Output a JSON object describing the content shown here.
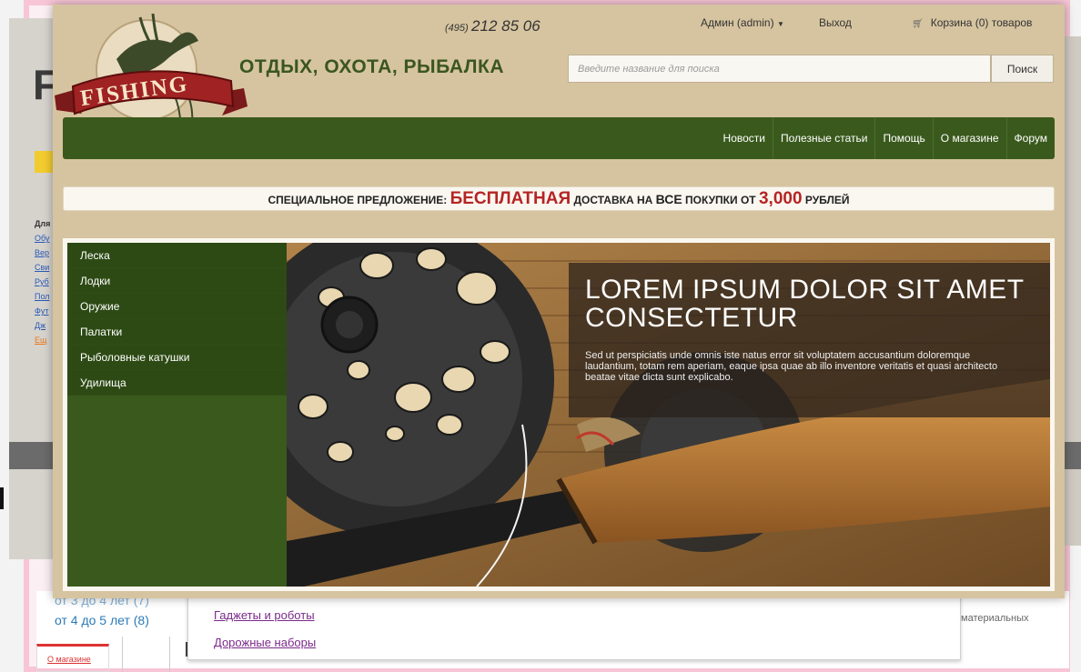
{
  "background": {
    "logo_fragment": "F",
    "side_links": [
      "Для",
      "Обу",
      "Вер",
      "Сви",
      "Руб",
      "Пол",
      "Фут",
      "Дж",
      "Ещ"
    ],
    "age_filters": [
      "от 4 до 5 лет (8)"
    ],
    "age_filter_partial": "от 3 до 4 лет (7)",
    "about_link": "О магазине",
    "dropdown_items": [
      "Гаджеты и роботы",
      "Дорожные наборы"
    ],
    "right_text": "материальных"
  },
  "header": {
    "phone_code": "(495)",
    "phone_number": "212 85 06",
    "brand_title": "ОТДЫХ, ОХОТА, РЫБАЛКА",
    "logo_text": "FISHING",
    "user_label": "Админ (admin)",
    "logout_label": "Выход",
    "cart_label": "Корзина (0) товаров"
  },
  "search": {
    "placeholder": "Введите название для поиска",
    "button_label": "Поиск"
  },
  "nav": {
    "items": [
      "Новости",
      "Полезные статьи",
      "Помощь",
      "О магазине",
      "Форум"
    ]
  },
  "promo": {
    "part1": "СПЕЦИАЛЬНОЕ ПРЕДЛОЖЕНИЕ:",
    "part2": "БЕСПЛАТНАЯ",
    "part3": "ДОСТАВКА НА",
    "part4": "ВСЕ",
    "part5": "ПОКУПКИ ОТ",
    "part6": "3,000",
    "part7": "РУБЛЕЙ"
  },
  "categories": [
    "Леска",
    "Лодки",
    "Оружие",
    "Палатки",
    "Рыболовные катушки",
    "Удилища"
  ],
  "hero": {
    "title": "LOREM IPSUM DOLOR SIT AMET CONSECTETUR",
    "text": "Sed ut perspiciatis unde omnis iste natus error sit voluptatem accusantium doloremque laudantium, totam rem aperiam, eaque ipsa quae ab illo inventore veritatis et quasi architecto beatae vitae dicta sunt explicabo."
  },
  "colors": {
    "header_bg": "#d6c4a0",
    "nav_green": "#3a5a1d",
    "promo_red": "#b52424",
    "brand_green": "#3b5620"
  }
}
